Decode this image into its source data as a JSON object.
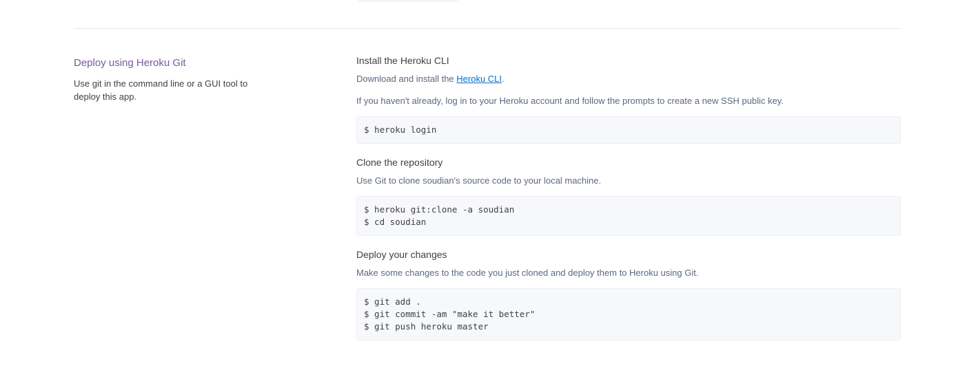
{
  "deploy_section": {
    "title": "Deploy using Heroku Git",
    "description": "Use git in the command line or a GUI tool to deploy this app."
  },
  "install_cli": {
    "title": "Install the Heroku CLI",
    "download_prefix": "Download and install the ",
    "download_link": "Heroku CLI",
    "download_suffix": ".",
    "login_text": "If you haven't already, log in to your Heroku account and follow the prompts to create a new SSH public key.",
    "code": [
      "$ heroku login"
    ]
  },
  "clone_repo": {
    "title": "Clone the repository",
    "text": "Use Git to clone soudian's source code to your local machine.",
    "code": [
      "$ heroku git:clone -a soudian",
      "$ cd soudian"
    ]
  },
  "deploy_changes": {
    "title": "Deploy your changes",
    "text": "Make some changes to the code you just cloned and deploy them to Heroku using Git.",
    "code": [
      "$ git add .",
      "$ git commit -am \"make it better\"",
      "$ git push heroku master"
    ]
  },
  "colors": {
    "section_title": "#79589f",
    "link": "#0070d2",
    "body_text": "#596981",
    "code_bg": "#f7f8fb"
  }
}
